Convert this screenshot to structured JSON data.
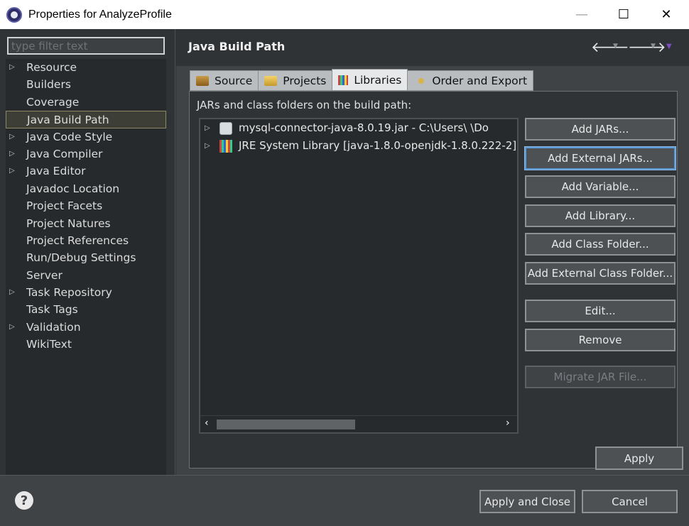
{
  "window": {
    "title": "Properties for AnalyzeProfile",
    "minimize": "—",
    "maximize": "☐",
    "close": "✕"
  },
  "filter": {
    "placeholder": "type filter text"
  },
  "tree": [
    {
      "label": "Resource",
      "expandable": true
    },
    {
      "label": "Builders",
      "expandable": false
    },
    {
      "label": "Coverage",
      "expandable": false
    },
    {
      "label": "Java Build Path",
      "expandable": false,
      "selected": true
    },
    {
      "label": "Java Code Style",
      "expandable": true
    },
    {
      "label": "Java Compiler",
      "expandable": true
    },
    {
      "label": "Java Editor",
      "expandable": true
    },
    {
      "label": "Javadoc Location",
      "expandable": false
    },
    {
      "label": "Project Facets",
      "expandable": false
    },
    {
      "label": "Project Natures",
      "expandable": false
    },
    {
      "label": "Project References",
      "expandable": false
    },
    {
      "label": "Run/Debug Settings",
      "expandable": false
    },
    {
      "label": "Server",
      "expandable": false
    },
    {
      "label": "Task Repository",
      "expandable": true
    },
    {
      "label": "Task Tags",
      "expandable": false
    },
    {
      "label": "Validation",
      "expandable": true
    },
    {
      "label": "WikiText",
      "expandable": false
    }
  ],
  "page": {
    "title": "Java Build Path",
    "tabs": [
      {
        "label": "Source",
        "icon": "source-icon"
      },
      {
        "label": "Projects",
        "icon": "projects-icon"
      },
      {
        "label": "Libraries",
        "icon": "libraries-icon",
        "active": true
      },
      {
        "label": "Order and Export",
        "icon": "order-export-icon"
      }
    ],
    "libraries_label": "JARs and class folders on the build path:",
    "entries": [
      {
        "label": "mysql-connector-java-8.0.19.jar - C:\\Users\\      \\Do",
        "icon": "jar-icon"
      },
      {
        "label": "JRE System Library [java-1.8.0-openjdk-1.8.0.222-2]",
        "icon": "jre-library-icon"
      }
    ],
    "buttons": {
      "add_jars": "Add JARs...",
      "add_external_jars": "Add External JARs...",
      "add_variable": "Add Variable...",
      "add_library": "Add Library...",
      "add_class_folder": "Add Class Folder...",
      "add_external_class_folder": "Add External Class Folder...",
      "edit": "Edit...",
      "remove": "Remove",
      "migrate_jar": "Migrate JAR File..."
    },
    "apply": "Apply"
  },
  "footer": {
    "help": "?",
    "apply_and_close": "Apply and Close",
    "cancel": "Cancel"
  }
}
